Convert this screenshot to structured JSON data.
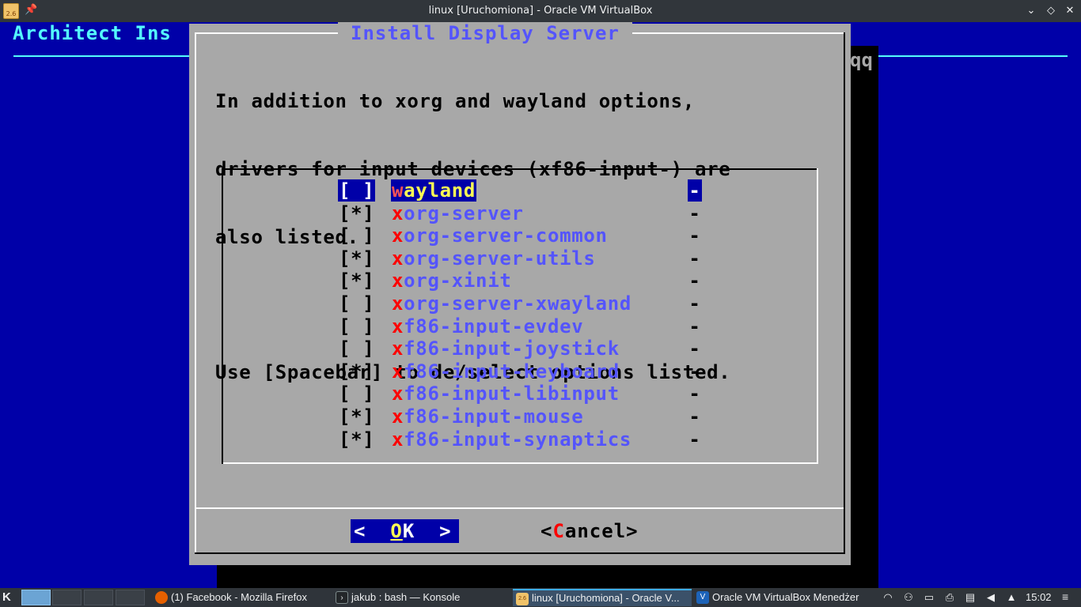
{
  "window": {
    "title": "linux [Uruchomiona] - Oracle VM VirtualBox",
    "app_icon_text": "2.6",
    "pin_glyph": "📌",
    "minimize_glyph": "⌄",
    "maximize_glyph": "◇",
    "close_glyph": "✕"
  },
  "vm": {
    "backtitle": "Architect Ins",
    "shadow_tail": "qq",
    "dialog": {
      "title": "Install Display Server",
      "text_lines": [
        "In addition to xorg and wayland options,",
        "drivers for input devices (xf86-input-) are",
        "also listed.",
        "",
        "Use [Spacebar] to de/select options listed."
      ],
      "items": [
        {
          "checkbox": "[ ]",
          "hotkey": "w",
          "rest": "ayland",
          "dash": "-",
          "selected": true
        },
        {
          "checkbox": "[*]",
          "hotkey": "x",
          "rest": "org-server",
          "dash": "-"
        },
        {
          "checkbox": "[ ]",
          "hotkey": "x",
          "rest": "org-server-common",
          "dash": "-"
        },
        {
          "checkbox": "[*]",
          "hotkey": "x",
          "rest": "org-server-utils",
          "dash": "-"
        },
        {
          "checkbox": "[*]",
          "hotkey": "x",
          "rest": "org-xinit",
          "dash": "-"
        },
        {
          "checkbox": "[ ]",
          "hotkey": "x",
          "rest": "org-server-xwayland",
          "dash": "-"
        },
        {
          "checkbox": "[ ]",
          "hotkey": "x",
          "rest": "f86-input-evdev",
          "dash": "-"
        },
        {
          "checkbox": "[ ]",
          "hotkey": "x",
          "rest": "f86-input-joystick",
          "dash": "-"
        },
        {
          "checkbox": "[*]",
          "hotkey": "x",
          "rest": "f86-input-keyboard",
          "dash": "-"
        },
        {
          "checkbox": "[ ]",
          "hotkey": "x",
          "rest": "f86-input-libinput",
          "dash": "-"
        },
        {
          "checkbox": "[*]",
          "hotkey": "x",
          "rest": "f86-input-mouse",
          "dash": "-"
        },
        {
          "checkbox": "[*]",
          "hotkey": "x",
          "rest": "f86-input-synaptics",
          "dash": "-"
        }
      ],
      "ok": {
        "prefix": "<  ",
        "hotkey": "O",
        "rest": "K  >"
      },
      "cancel": {
        "prefix": "<",
        "hotkey": "C",
        "rest": "ancel>"
      }
    }
  },
  "taskbar": {
    "launcher_glyph": "K",
    "tasks": [
      {
        "label": "(1) Facebook - Mozilla Firefox",
        "icon": "firefox-icon",
        "active": false
      },
      {
        "label": "jakub : bash — Konsole",
        "icon": "konsole-icon",
        "active": false
      },
      {
        "label": "linux [Uruchomiona] - Oracle V...",
        "icon": "virtualbox-vm-icon",
        "active": true
      },
      {
        "label": "Oracle VM VirtualBox Menedżer",
        "icon": "virtualbox-manager-icon",
        "active": false
      }
    ],
    "clock": "15:02",
    "colors": {
      "accent": "#3daee9",
      "vm_background": "#0000a8",
      "dialog": "#a8a8a8"
    }
  }
}
